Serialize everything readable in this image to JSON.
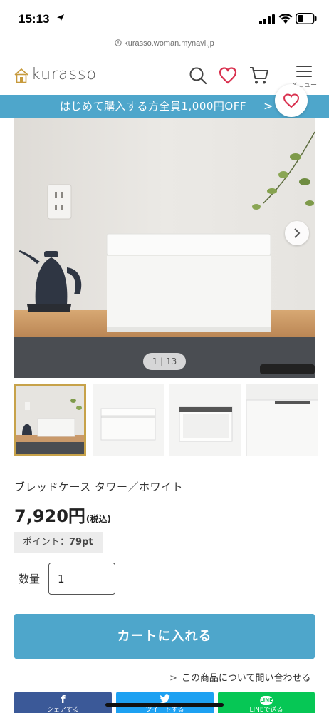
{
  "status_bar": {
    "time": "15:13"
  },
  "browser": {
    "url": "kurasso.woman.mynavi.jp"
  },
  "header": {
    "logo_text": "kurasso",
    "menu_label": "メニュー"
  },
  "promo": {
    "text": "はじめて購入する方全員1,000円OFF",
    "arrow": ">"
  },
  "gallery": {
    "counter": "1 | 13",
    "total_images": 13,
    "current_image": 1
  },
  "product": {
    "name": "ブレッドケース タワー／ホワイト",
    "price": "7,920円",
    "tax_note": "(税込)",
    "points_label": "ポイント：",
    "points_value": "79pt"
  },
  "quantity": {
    "label": "数量",
    "value": "1"
  },
  "actions": {
    "add_to_cart": "カートに入れる",
    "inquiry_chevron": ">",
    "inquiry": "この商品について問い合わせる"
  },
  "share": {
    "facebook_icon": "f",
    "facebook_label": "シェアする",
    "twitter_label": "ツイートする",
    "line_icon": "LINE",
    "line_label": "LINEで送る"
  },
  "colors": {
    "accent": "#4ea6cb",
    "heart": "#d9304e",
    "active_thumb_border": "#c7a24a",
    "facebook": "#3b5998",
    "twitter": "#1da1f2",
    "line": "#06c755"
  }
}
